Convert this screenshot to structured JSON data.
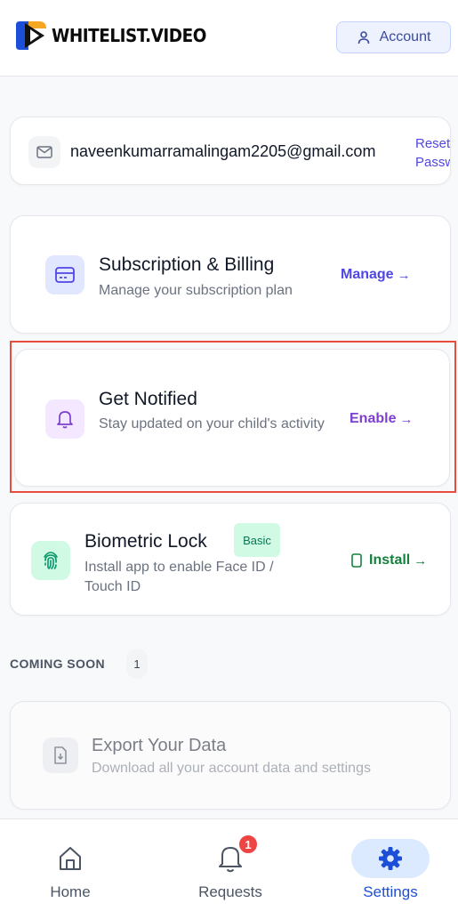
{
  "header": {
    "logo_text": "WHITELIST.VIDEO",
    "account_label": "Account"
  },
  "email_card": {
    "email": "naveenkumarramalingam2205@gmail.com",
    "reset_line1": "Reset",
    "reset_line2": "Password"
  },
  "billing": {
    "title": "Subscription & Billing",
    "subtitle": "Manage your subscription plan",
    "action_label": "Manage",
    "arrow": "→",
    "icon": "credit-card-icon"
  },
  "notify": {
    "title": "Get Notified",
    "subtitle": "Stay updated on your child's activity",
    "action_label": "Enable",
    "arrow": "→",
    "icon": "bell-icon"
  },
  "biometric": {
    "title": "Biometric Lock",
    "badge": "Basic",
    "subtitle": "Install app to enable Face ID / Touch ID",
    "action_label": "Install",
    "arrow": "→",
    "icon": "fingerprint-icon"
  },
  "coming_soon": {
    "label": "COMING SOON",
    "count": "1",
    "items": [
      {
        "title": "Export Your Data",
        "subtitle": "Download all your account data and settings",
        "icon": "file-download-icon"
      }
    ]
  },
  "bottom_nav": {
    "items": [
      {
        "label": "Home",
        "icon": "home-icon"
      },
      {
        "label": "Requests",
        "icon": "bell-icon",
        "badge": "1"
      },
      {
        "label": "Settings",
        "icon": "gear-icon",
        "active": true
      }
    ]
  },
  "colors": {
    "accent_indigo": "#4f46e5",
    "notify_purple": "#7e3fd0",
    "install_green": "#15803d",
    "highlight_red": "#e74c3c",
    "active_nav": "#1d4ed8"
  }
}
